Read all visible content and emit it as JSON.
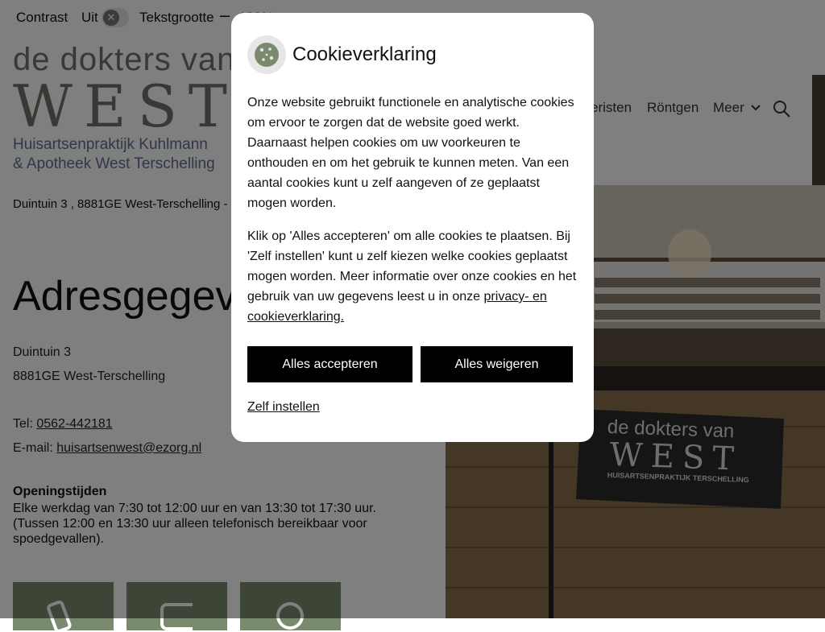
{
  "topbar": {
    "contrast_label": "Contrast",
    "contrast_state": "Uit",
    "contrast_toggle_glyph": "✕",
    "textsize_label": "Tekstgrootte",
    "textsize_minus": "–",
    "textsize_value": "100%"
  },
  "logo": {
    "line1": "de dokters van",
    "line2": "WEST",
    "line3": "Huisartsenpraktijk Kuhlmann",
    "line4": "& Apotheek West Terschelling"
  },
  "nav": {
    "item1": "eristen",
    "item2": "Röntgen",
    "item3": "Meer",
    "search_icon": "search-icon"
  },
  "address_line": "Duintuin 3 , 8881GE West-Terschelling -",
  "page_title": "Adresgegev",
  "address": {
    "street": "Duintuin 3",
    "city": "8881GE West-Terschelling",
    "tel_label": "Tel:",
    "tel_value": "0562-442181",
    "email_label": "E-mail:",
    "email_value": "huisartsenwest@ezorg.nl"
  },
  "hours": {
    "title": "Openingstijden",
    "text": "Elke werkdag van 7:30 tot 12:00 uur en van 13:30 tot 17:30 uur. (Tussen 12:00 en 13:30 uur alleen telefonisch bereikbaar voor spoedgevallen)."
  },
  "photo": {
    "sign_line1": "de dokters van",
    "sign_line2": "WEST",
    "sign_line3": "HUISARTSENPRAKTIJK TERSCHELLING"
  },
  "modal": {
    "title": "Cookieverklaring",
    "icon": "cookie-icon",
    "paragraph1": "Onze website gebruikt functionele en analytische cookies om ervoor te zorgen dat de website goed werkt. Daarnaast helpen cookies om uw voorkeuren te onthouden en om het gebruik te kunnen meten. Van een aantal cookies kunt u zelf aangeven of ze geplaatst mogen worden.",
    "paragraph2_text": "Klik op 'Alles accepteren' om alle cookies te plaatsen. Bij 'Zelf instellen' kunt u zelf kiezen welke cookies geplaatst mogen worden. Meer informatie over onze cookies en het gebruik van uw gegevens leest u in onze ",
    "paragraph2_link": "privacy- en cookieverklaring.",
    "accept_button": "Alles accepteren",
    "reject_button": "Alles weigeren",
    "custom_link": "Zelf instellen"
  },
  "colors": {
    "overlay": "#000000",
    "button_bg": "#000000",
    "button_text": "#ffffff",
    "logo_green": "#6f7468",
    "logo_blue": "#5d7090",
    "tile_green": "#7a8a6e"
  }
}
